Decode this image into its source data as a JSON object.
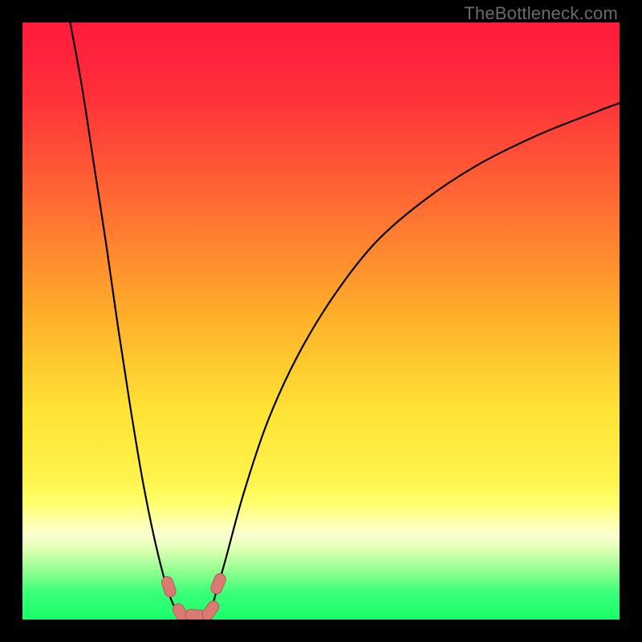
{
  "watermark": "TheBottleneck.com",
  "colors": {
    "frame": "#000000",
    "curve": "#000000",
    "marker_fill": "#da7a72",
    "marker_stroke": "#b85a54",
    "gradient_stops": [
      {
        "offset": 0.0,
        "color": "#ff1a3c"
      },
      {
        "offset": 0.12,
        "color": "#ff2f3a"
      },
      {
        "offset": 0.3,
        "color": "#ff6a33"
      },
      {
        "offset": 0.5,
        "color": "#ffb22a"
      },
      {
        "offset": 0.65,
        "color": "#ffe335"
      },
      {
        "offset": 0.76,
        "color": "#fff24a"
      },
      {
        "offset": 0.8,
        "color": "#ffff66"
      },
      {
        "offset": 0.835,
        "color": "#ffffaa"
      },
      {
        "offset": 0.86,
        "color": "#fbffd0"
      },
      {
        "offset": 0.885,
        "color": "#d9ffb0"
      },
      {
        "offset": 0.92,
        "color": "#8eff90"
      },
      {
        "offset": 0.955,
        "color": "#3aff78"
      },
      {
        "offset": 1.0,
        "color": "#1aff6a"
      }
    ]
  },
  "chart_data": {
    "type": "line",
    "title": "",
    "xlabel": "",
    "ylabel": "",
    "xlim": [
      0,
      100
    ],
    "ylim": [
      0,
      100
    ],
    "grid": false,
    "legend": false,
    "series": [
      {
        "name": "bottleneck-curve-left",
        "x": [
          8,
          10,
          12,
          14,
          16,
          18,
          20,
          22,
          24,
          25.5,
          27
        ],
        "y": [
          100,
          89,
          76,
          63,
          49,
          36,
          24,
          14,
          6,
          2,
          0
        ]
      },
      {
        "name": "bottleneck-curve-right",
        "x": [
          31,
          32,
          34,
          37,
          41,
          46,
          52,
          59,
          67,
          76,
          86,
          96,
          100
        ],
        "y": [
          0,
          3,
          10,
          21,
          33,
          44,
          54,
          63,
          70,
          76,
          81,
          85,
          86.5
        ]
      }
    ],
    "markers": [
      {
        "x": 24.5,
        "y": 5.5,
        "label": "left-upper"
      },
      {
        "x": 26.5,
        "y": 1.0,
        "label": "left-lower"
      },
      {
        "x": 29.0,
        "y": 0.7,
        "label": "bottom"
      },
      {
        "x": 31.5,
        "y": 1.5,
        "label": "right-lower"
      },
      {
        "x": 32.8,
        "y": 6.0,
        "label": "right-upper"
      }
    ]
  }
}
